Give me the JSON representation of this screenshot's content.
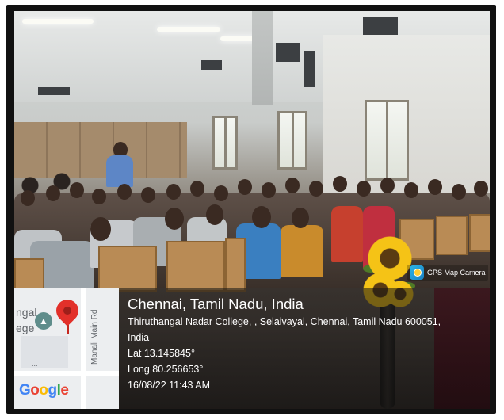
{
  "photo": {
    "badge_label": "GPS Map Camera",
    "icons": {
      "pin": "map-pin-icon",
      "education": "graduation-cap-icon",
      "app": "gps-map-camera-icon"
    }
  },
  "overlay": {
    "location_title": "Chennai, Tamil Nadu, India",
    "address_line1": "Thiruthangal Nadar College, , Selaivayal, Chennai, Tamil Nadu 600051,",
    "address_line2": "India",
    "latitude": "Lat 13.145845°",
    "longitude": "Long 80.256653°",
    "timestamp": "16/08/22 11:43 AM"
  },
  "map": {
    "place_partial_1": "ngal",
    "place_partial_2": "ege",
    "road_label": "Manali Main Rd",
    "logo": "Google"
  }
}
